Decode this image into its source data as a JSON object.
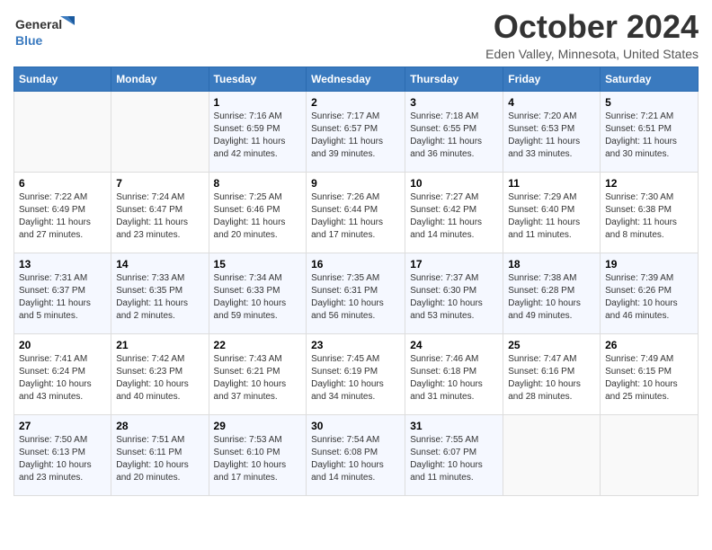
{
  "header": {
    "logo_line1": "General",
    "logo_line2": "Blue",
    "month_title": "October 2024",
    "location": "Eden Valley, Minnesota, United States"
  },
  "days_of_week": [
    "Sunday",
    "Monday",
    "Tuesday",
    "Wednesday",
    "Thursday",
    "Friday",
    "Saturday"
  ],
  "weeks": [
    [
      {
        "day": "",
        "info": ""
      },
      {
        "day": "",
        "info": ""
      },
      {
        "day": "1",
        "info": "Sunrise: 7:16 AM\nSunset: 6:59 PM\nDaylight: 11 hours and 42 minutes."
      },
      {
        "day": "2",
        "info": "Sunrise: 7:17 AM\nSunset: 6:57 PM\nDaylight: 11 hours and 39 minutes."
      },
      {
        "day": "3",
        "info": "Sunrise: 7:18 AM\nSunset: 6:55 PM\nDaylight: 11 hours and 36 minutes."
      },
      {
        "day": "4",
        "info": "Sunrise: 7:20 AM\nSunset: 6:53 PM\nDaylight: 11 hours and 33 minutes."
      },
      {
        "day": "5",
        "info": "Sunrise: 7:21 AM\nSunset: 6:51 PM\nDaylight: 11 hours and 30 minutes."
      }
    ],
    [
      {
        "day": "6",
        "info": "Sunrise: 7:22 AM\nSunset: 6:49 PM\nDaylight: 11 hours and 27 minutes."
      },
      {
        "day": "7",
        "info": "Sunrise: 7:24 AM\nSunset: 6:47 PM\nDaylight: 11 hours and 23 minutes."
      },
      {
        "day": "8",
        "info": "Sunrise: 7:25 AM\nSunset: 6:46 PM\nDaylight: 11 hours and 20 minutes."
      },
      {
        "day": "9",
        "info": "Sunrise: 7:26 AM\nSunset: 6:44 PM\nDaylight: 11 hours and 17 minutes."
      },
      {
        "day": "10",
        "info": "Sunrise: 7:27 AM\nSunset: 6:42 PM\nDaylight: 11 hours and 14 minutes."
      },
      {
        "day": "11",
        "info": "Sunrise: 7:29 AM\nSunset: 6:40 PM\nDaylight: 11 hours and 11 minutes."
      },
      {
        "day": "12",
        "info": "Sunrise: 7:30 AM\nSunset: 6:38 PM\nDaylight: 11 hours and 8 minutes."
      }
    ],
    [
      {
        "day": "13",
        "info": "Sunrise: 7:31 AM\nSunset: 6:37 PM\nDaylight: 11 hours and 5 minutes."
      },
      {
        "day": "14",
        "info": "Sunrise: 7:33 AM\nSunset: 6:35 PM\nDaylight: 11 hours and 2 minutes."
      },
      {
        "day": "15",
        "info": "Sunrise: 7:34 AM\nSunset: 6:33 PM\nDaylight: 10 hours and 59 minutes."
      },
      {
        "day": "16",
        "info": "Sunrise: 7:35 AM\nSunset: 6:31 PM\nDaylight: 10 hours and 56 minutes."
      },
      {
        "day": "17",
        "info": "Sunrise: 7:37 AM\nSunset: 6:30 PM\nDaylight: 10 hours and 53 minutes."
      },
      {
        "day": "18",
        "info": "Sunrise: 7:38 AM\nSunset: 6:28 PM\nDaylight: 10 hours and 49 minutes."
      },
      {
        "day": "19",
        "info": "Sunrise: 7:39 AM\nSunset: 6:26 PM\nDaylight: 10 hours and 46 minutes."
      }
    ],
    [
      {
        "day": "20",
        "info": "Sunrise: 7:41 AM\nSunset: 6:24 PM\nDaylight: 10 hours and 43 minutes."
      },
      {
        "day": "21",
        "info": "Sunrise: 7:42 AM\nSunset: 6:23 PM\nDaylight: 10 hours and 40 minutes."
      },
      {
        "day": "22",
        "info": "Sunrise: 7:43 AM\nSunset: 6:21 PM\nDaylight: 10 hours and 37 minutes."
      },
      {
        "day": "23",
        "info": "Sunrise: 7:45 AM\nSunset: 6:19 PM\nDaylight: 10 hours and 34 minutes."
      },
      {
        "day": "24",
        "info": "Sunrise: 7:46 AM\nSunset: 6:18 PM\nDaylight: 10 hours and 31 minutes."
      },
      {
        "day": "25",
        "info": "Sunrise: 7:47 AM\nSunset: 6:16 PM\nDaylight: 10 hours and 28 minutes."
      },
      {
        "day": "26",
        "info": "Sunrise: 7:49 AM\nSunset: 6:15 PM\nDaylight: 10 hours and 25 minutes."
      }
    ],
    [
      {
        "day": "27",
        "info": "Sunrise: 7:50 AM\nSunset: 6:13 PM\nDaylight: 10 hours and 23 minutes."
      },
      {
        "day": "28",
        "info": "Sunrise: 7:51 AM\nSunset: 6:11 PM\nDaylight: 10 hours and 20 minutes."
      },
      {
        "day": "29",
        "info": "Sunrise: 7:53 AM\nSunset: 6:10 PM\nDaylight: 10 hours and 17 minutes."
      },
      {
        "day": "30",
        "info": "Sunrise: 7:54 AM\nSunset: 6:08 PM\nDaylight: 10 hours and 14 minutes."
      },
      {
        "day": "31",
        "info": "Sunrise: 7:55 AM\nSunset: 6:07 PM\nDaylight: 10 hours and 11 minutes."
      },
      {
        "day": "",
        "info": ""
      },
      {
        "day": "",
        "info": ""
      }
    ]
  ]
}
